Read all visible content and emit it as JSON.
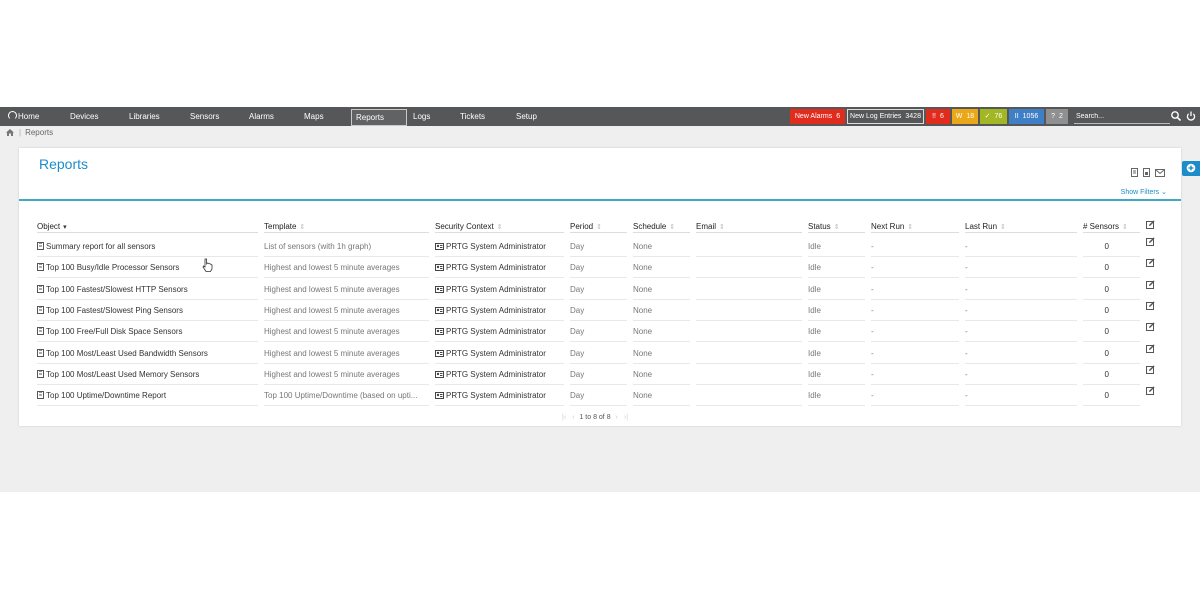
{
  "nav": {
    "home": "Home",
    "items": [
      "Devices",
      "Libraries",
      "Sensors",
      "Alarms",
      "Maps",
      "Reports",
      "Logs",
      "Tickets",
      "Setup"
    ],
    "active": "Reports"
  },
  "status": {
    "new_alarms_label": "New Alarms",
    "new_alarms_count": "6",
    "new_log_label": "New Log Entries",
    "new_log_count": "3428",
    "down_icon": "!!",
    "down_count": "6",
    "warning_icon": "W",
    "warning_count": "18",
    "up_icon": "✓",
    "up_count": "76",
    "paused_icon": "II",
    "paused_count": "1056",
    "unknown_icon": "?",
    "unknown_count": "2",
    "colors": {
      "alarm": "#e12b1d",
      "down": "#e12b1d",
      "warning": "#eaa718",
      "up": "#a3b624",
      "paused": "#3f7fc5",
      "unknown": "#909090"
    }
  },
  "search": {
    "placeholder": "Search..."
  },
  "breadcrumb": {
    "current": "Reports"
  },
  "page": {
    "title": "Reports",
    "show_filters": "Show Filters"
  },
  "table": {
    "columns": {
      "object": "Object",
      "template": "Template",
      "security": "Security Context",
      "period": "Period",
      "schedule": "Schedule",
      "email": "Email",
      "status": "Status",
      "next_run": "Next Run",
      "last_run": "Last Run",
      "sensors": "# Sensors"
    },
    "rows": [
      {
        "object": "Summary report for all sensors",
        "template": "List of sensors (with 1h graph)",
        "security": "PRTG System Administrator",
        "period": "Day",
        "schedule": "None",
        "email": "",
        "status": "Idle",
        "next_run": "-",
        "last_run": "-",
        "sensors": "0"
      },
      {
        "object": "Top 100 Busy/Idle Processor Sensors",
        "template": "Highest and lowest 5 minute averages",
        "security": "PRTG System Administrator",
        "period": "Day",
        "schedule": "None",
        "email": "",
        "status": "Idle",
        "next_run": "-",
        "last_run": "-",
        "sensors": "0"
      },
      {
        "object": "Top 100 Fastest/Slowest HTTP Sensors",
        "template": "Highest and lowest 5 minute averages",
        "security": "PRTG System Administrator",
        "period": "Day",
        "schedule": "None",
        "email": "",
        "status": "Idle",
        "next_run": "-",
        "last_run": "-",
        "sensors": "0"
      },
      {
        "object": "Top 100 Fastest/Slowest Ping Sensors",
        "template": "Highest and lowest 5 minute averages",
        "security": "PRTG System Administrator",
        "period": "Day",
        "schedule": "None",
        "email": "",
        "status": "Idle",
        "next_run": "-",
        "last_run": "-",
        "sensors": "0"
      },
      {
        "object": "Top 100 Free/Full Disk Space Sensors",
        "template": "Highest and lowest 5 minute averages",
        "security": "PRTG System Administrator",
        "period": "Day",
        "schedule": "None",
        "email": "",
        "status": "Idle",
        "next_run": "-",
        "last_run": "-",
        "sensors": "0"
      },
      {
        "object": "Top 100 Most/Least Used Bandwidth Sensors",
        "template": "Highest and lowest 5 minute averages",
        "security": "PRTG System Administrator",
        "period": "Day",
        "schedule": "None",
        "email": "",
        "status": "Idle",
        "next_run": "-",
        "last_run": "-",
        "sensors": "0"
      },
      {
        "object": "Top 100 Most/Least Used Memory Sensors",
        "template": "Highest and lowest 5 minute averages",
        "security": "PRTG System Administrator",
        "period": "Day",
        "schedule": "None",
        "email": "",
        "status": "Idle",
        "next_run": "-",
        "last_run": "-",
        "sensors": "0"
      },
      {
        "object": "Top 100 Uptime/Downtime Report",
        "template": "Top 100 Uptime/Downtime (based on upti...",
        "security": "PRTG System Administrator",
        "period": "Day",
        "schedule": "None",
        "email": "",
        "status": "Idle",
        "next_run": "-",
        "last_run": "-",
        "sensors": "0"
      }
    ],
    "pager": "1 to 8 of 8"
  }
}
